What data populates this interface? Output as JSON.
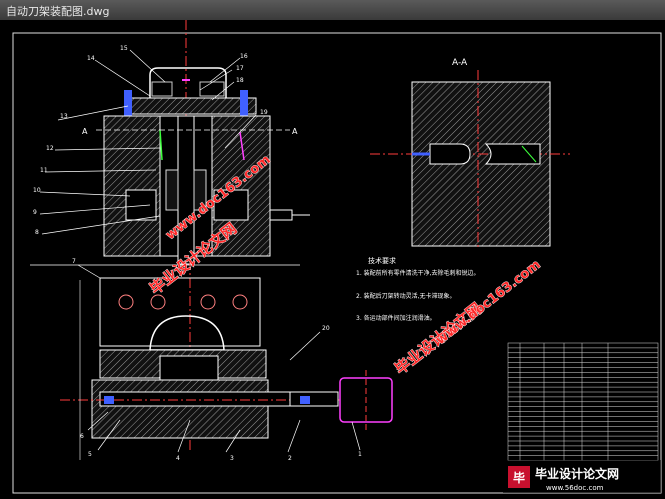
{
  "window": {
    "title": "自动刀架装配图.dwg"
  },
  "drawing": {
    "section_label": "A-A",
    "cut_label_left": "A",
    "cut_label_right": "A",
    "balloons_top": [
      "14",
      "15",
      "16",
      "17",
      "18",
      "13",
      "19",
      "12",
      "11",
      "10",
      "9",
      "8"
    ],
    "balloons_bottom": [
      "7",
      "6",
      "5",
      "4",
      "3",
      "2",
      "1",
      "20"
    ],
    "tech_title": "技术要求",
    "tech_lines": [
      "1. 装配前所有零件清洗干净,去除毛刺和锐边。",
      "2. 装配后刀架转动灵活,无卡滞现象。",
      "3. 各运动部件间加注润滑油。"
    ],
    "bom_rows": 24
  },
  "watermarks": {
    "cn_text": "毕业设计论文网",
    "url_text": "www.doc163.com",
    "logo_cn": "毕业设计论文网",
    "logo_url": "www.56doc.com"
  },
  "colors": {
    "bg": "#000000",
    "line": "#ffffff",
    "center": "#ff3b3b",
    "dim": "#3cff3c",
    "watermark": "#ff2a2a",
    "blue": "#4060ff",
    "magenta": "#ff40ff"
  }
}
